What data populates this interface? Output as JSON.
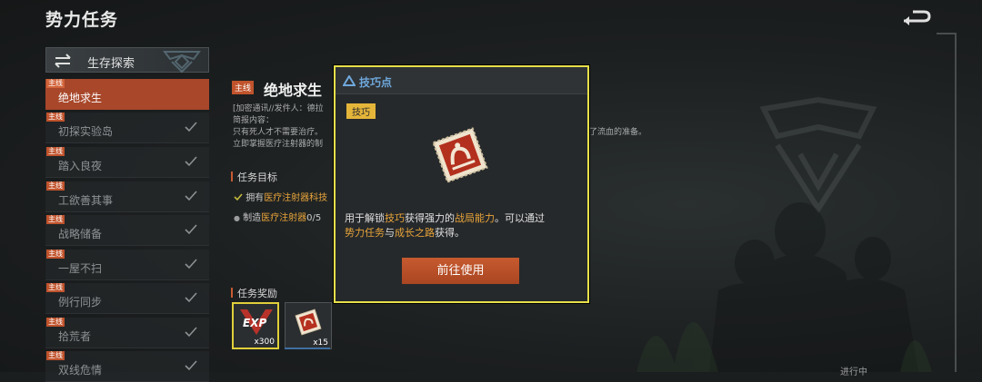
{
  "header": {
    "title": "势力任务"
  },
  "sidebar": {
    "heading": "生存探索",
    "tag": "主线",
    "items": [
      {
        "label": "绝地求生"
      },
      {
        "label": "初探实验岛"
      },
      {
        "label": "踏入良夜"
      },
      {
        "label": "工欲善其事"
      },
      {
        "label": "战略储备"
      },
      {
        "label": "一屋不扫"
      },
      {
        "label": "例行同步"
      },
      {
        "label": "拾荒者"
      },
      {
        "label": "双线危情"
      }
    ]
  },
  "mission": {
    "tag": "主线",
    "title": "绝地求生",
    "desc_line1": "[加密通讯//发件人：德拉",
    "desc_line2": "简报内容：",
    "desc_line3": "只有死人才不需要治疗。",
    "desc_line3_tail": "了流血的准备。",
    "desc_line4": "立即掌握医疗注射器的制",
    "objectives_heading": "任务目标",
    "objective1_prefix": "拥有",
    "objective1_hl": "医疗注射器科技",
    "objective2_prefix": "制造",
    "objective2_hl": "医疗注射器",
    "objective2_suffix": "0/5",
    "rewards_heading": "任务奖励",
    "reward1_qty": "x300",
    "reward1_label": "EXP",
    "reward2_qty": "x15",
    "progress_label": "进行中"
  },
  "popup": {
    "title": "技巧点",
    "tag": "技巧",
    "desc1_a": "用于解锁",
    "desc1_hl1": "技巧",
    "desc1_b": "获得强力的",
    "desc1_hl2": "战局能力",
    "desc1_c": "。可以通过",
    "desc2_hl1": "势力任务",
    "desc2_a": "与",
    "desc2_hl2": "成长之路",
    "desc2_b": "获得。",
    "button_label": "前往使用"
  },
  "colors": {
    "accent_orange": "#c0532c",
    "highlight": "#e8a43a",
    "popup_border": "#e6e04a",
    "popup_title": "#6fa8dc"
  }
}
